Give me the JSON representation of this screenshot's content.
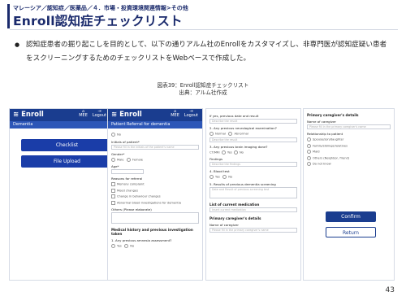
{
  "header": {
    "breadcrumb": "マレーシア／認知症／医薬品／４．市場・投資環境関連情報>その他",
    "title": "Enroll認知症チェックリスト"
  },
  "body": {
    "bullet": "●",
    "text": "認知症患者の掘り起こしを目的として、以下の通りアルム社のEnrollをカスタマイズし、非専門医が認知症疑い患者をスクリーニングするためのチェックリストをWebベースで作成した。"
  },
  "figure": {
    "caption": "図表39：Enroll認知症チェックリスト",
    "source": "出典：アルム社作成"
  },
  "screen1": {
    "app_title": "Enroll",
    "icon1_label": "MEE",
    "icon2_label": "Logout",
    "subtitle": "Dementia",
    "checklist_button": "Checklist",
    "upload_button": "File Upload"
  },
  "screen2": {
    "app_title": "Enroll",
    "icon1_label": "MEE",
    "icon2_label": "Logout",
    "subtitle": "Patient Referral for dementia",
    "opt_no": "No",
    "initials_label": "Initials of patient*",
    "initials_placeholder": "Please fill in the initials of the patient's name",
    "gender_label": "Gender*",
    "male": "Male",
    "female": "Female",
    "age_label": "Age*",
    "reasons_label": "Reasons for referral",
    "r1": "Memory complaint",
    "r2": "Mood changes",
    "r3": "Change in behaviour changes",
    "r4": "Abnormal blood investigations for dementia",
    "others_label": "Others (Please elaborate)",
    "history_label": "Medical history and previous investigation taken",
    "q1": "1. Any previous amnesia assessment?",
    "yes": "Yes",
    "no": "No"
  },
  "screen3": {
    "q_top": "If yes, previous date and result",
    "q_top_placeholder": "Describe the result",
    "q2": "2. Any previous neurological examination?",
    "normal": "Normal",
    "abnormal": "Abnormal",
    "q2_placeholder": "Describe the result",
    "q3": "3. Any previous brain imaging done?",
    "ct_mri": "CT/MRI",
    "yes": "Yes",
    "no": "No",
    "findings_label": "Findings",
    "findings_placeholder": "Describe the findings",
    "q4": "4. Blood test",
    "q4_yes": "Yes",
    "q4_no": "No",
    "q5": "5. Results of previous dementia screening",
    "q5_placeholder": "Date and Result of previous screening test",
    "meds_label": "List of current medication",
    "meds_placeholder": "Insert current medication",
    "caregiver_section": "Primary caregiver's details",
    "caregiver_name_label": "Name of caregiver",
    "caregiver_name_placeholder": "Please fill in the primary caregiver's name"
  },
  "screen4": {
    "caregiver_details": "Primary caregiver's details",
    "name_label": "Name of caregiver",
    "name_placeholder": "Please fill in the primary caregiver's name",
    "relationship_label": "Relationship to patient",
    "rel1": "Spouse/son/daughter",
    "rel2": "Family/siblings/relatives",
    "rel3": "Maid",
    "rel4": "Others (Neighbor, friend)",
    "rel5": "Do not know",
    "confirm_button": "Confirm",
    "return_button": "Return"
  },
  "footer": {
    "page_number": "43"
  }
}
